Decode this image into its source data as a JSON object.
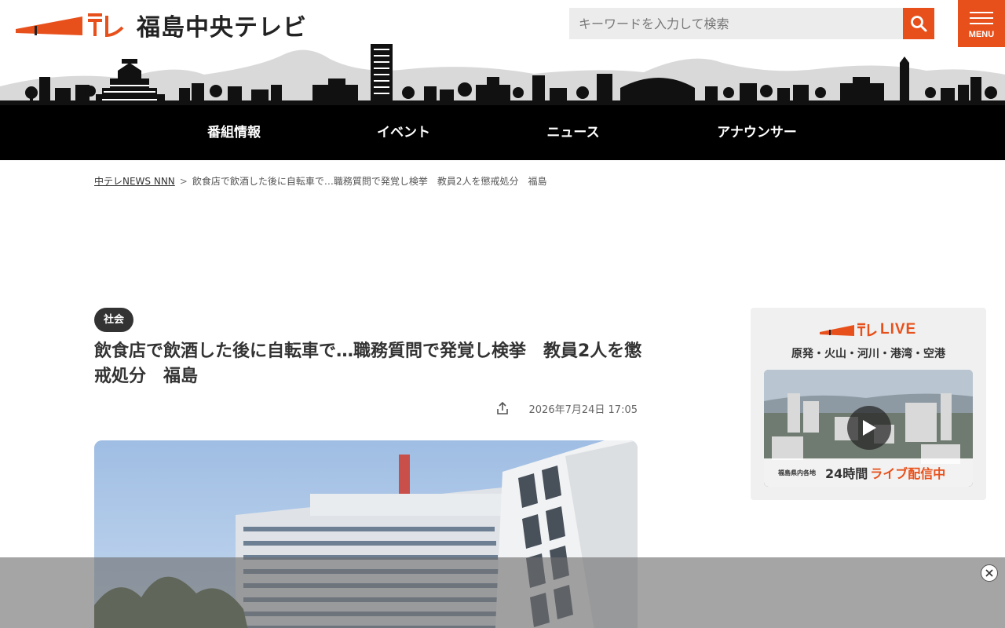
{
  "header": {
    "logo_text": "福島中央テレビ",
    "search": {
      "placeholder": "キーワードを入力して検索"
    },
    "menu_label": "MENU"
  },
  "nav": {
    "items": [
      {
        "label": "番組情報"
      },
      {
        "label": "イベント"
      },
      {
        "label": "ニュース"
      },
      {
        "label": "アナウンサー"
      }
    ]
  },
  "breadcrumb": {
    "home": "中テレNEWS NNN",
    "separator": ">",
    "current": "飲食店で飲酒した後に自転車で…職務質問で発覚し検挙　教員2人を懲戒処分　福島"
  },
  "article": {
    "category": "社会",
    "title": "飲食店で飲酒した後に自転車で…職務質問で発覚し検挙　教員2人を懲戒処分　福島",
    "date": "2026年7月24日 17:05"
  },
  "sidebar": {
    "live": {
      "word": "LIVE",
      "subtitle": "原発・火山・河川・港湾・空港",
      "banner_small": "福島県内各地",
      "banner_hours": "24時間",
      "banner_live": "ライブ配信中"
    }
  },
  "colors": {
    "accent": "#e8501b",
    "nav_bg": "#000000",
    "tag_bg": "#333333"
  },
  "icons": {
    "search": "search-icon",
    "menu": "hamburger-icon",
    "share": "share-icon",
    "play": "play-icon",
    "close": "close-icon"
  }
}
